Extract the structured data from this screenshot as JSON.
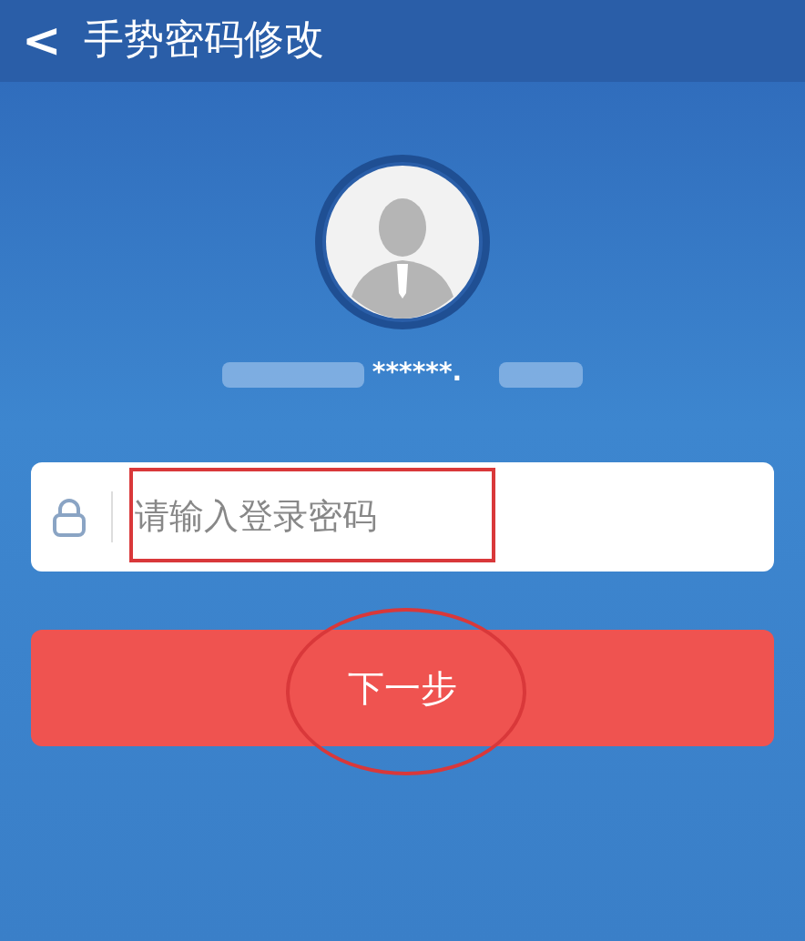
{
  "header": {
    "back": "<",
    "title": "手势密码修改"
  },
  "account": {
    "masked": "******."
  },
  "password": {
    "placeholder": "请输入登录密码"
  },
  "next_button": {
    "label": "下一步"
  }
}
